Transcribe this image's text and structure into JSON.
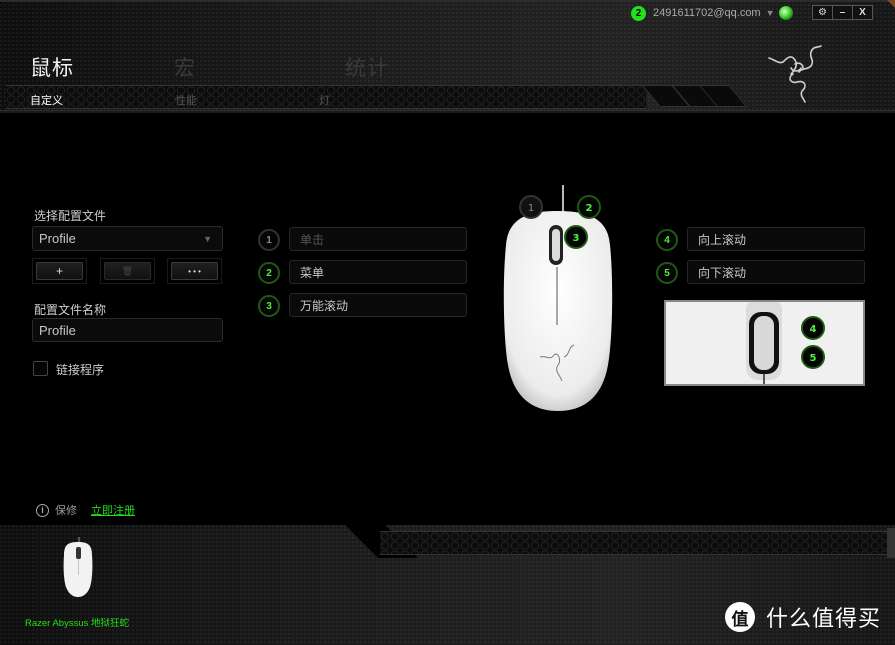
{
  "header": {
    "main_tabs": [
      {
        "label": "鼠标",
        "active": true
      },
      {
        "label": "宏",
        "active": false
      },
      {
        "label": "统计",
        "active": false
      }
    ],
    "sub_tabs": [
      {
        "label": "自定义",
        "active": true
      },
      {
        "label": "性能",
        "active": false
      },
      {
        "label": "灯",
        "active": false
      }
    ]
  },
  "account": {
    "notification_count": "2",
    "email": "2491611702@qq.com",
    "caret_icon": "▼",
    "status_icon": "online-status-orb"
  },
  "window_controls": {
    "settings": "⚙",
    "minimize": "–",
    "close": "X"
  },
  "profile_panel": {
    "select_label": "选择配置文件",
    "selected_profile": "Profile",
    "select_caret": "▼",
    "buttons": {
      "add": "+",
      "delete": "🗑",
      "more": "• • •"
    },
    "name_label": "配置文件名称",
    "name_value": "Profile",
    "link_program_label": "链接程序",
    "link_program_checked": false
  },
  "button_mapping": {
    "left": [
      {
        "number": "1",
        "action": "单击",
        "enabled": false
      },
      {
        "number": "2",
        "action": "菜单",
        "enabled": true
      },
      {
        "number": "3",
        "action": "万能滚动",
        "enabled": true
      }
    ],
    "right": [
      {
        "number": "4",
        "action": "向上滚动",
        "enabled": true
      },
      {
        "number": "5",
        "action": "向下滚动",
        "enabled": true
      }
    ],
    "mouse_markers": [
      "1",
      "2",
      "3"
    ],
    "zoom_markers": [
      "4",
      "5"
    ]
  },
  "warranty": {
    "info_icon": "i",
    "label": "保修",
    "register_link": "立即注册"
  },
  "footer": {
    "device_name": "Razer Abyssus 地狱狂蛇"
  },
  "watermark": {
    "logo_char": "值",
    "text": "什么值得买"
  },
  "colors": {
    "accent_green": "#22e01b",
    "badge_green": "#4df03a",
    "background": "#000000"
  }
}
